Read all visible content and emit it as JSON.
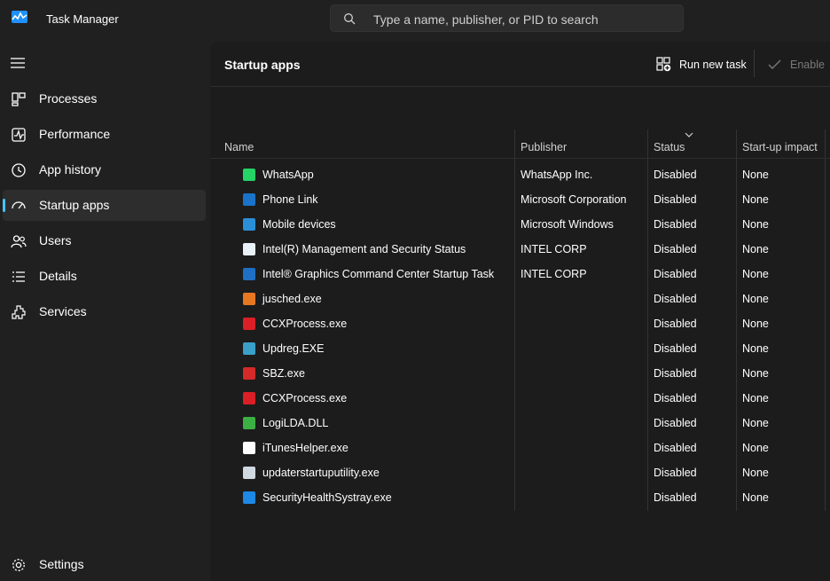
{
  "window": {
    "title": "Task Manager"
  },
  "search": {
    "placeholder": "Type a name, publisher, or PID to search"
  },
  "sidebar": {
    "items": [
      {
        "label": "Processes",
        "icon": "processes-icon"
      },
      {
        "label": "Performance",
        "icon": "performance-icon"
      },
      {
        "label": "App history",
        "icon": "app-history-icon"
      },
      {
        "label": "Startup apps",
        "icon": "startup-apps-icon",
        "active": true
      },
      {
        "label": "Users",
        "icon": "users-icon"
      },
      {
        "label": "Details",
        "icon": "details-icon"
      },
      {
        "label": "Services",
        "icon": "services-icon"
      }
    ],
    "settings_label": "Settings"
  },
  "page": {
    "title": "Startup apps",
    "run_new_task_label": "Run new task",
    "enable_label": "Enable"
  },
  "table": {
    "columns": {
      "name": "Name",
      "publisher": "Publisher",
      "status": "Status",
      "impact": "Start-up impact"
    },
    "rows": [
      {
        "name": "WhatsApp",
        "publisher": "WhatsApp Inc.",
        "status": "Disabled",
        "impact": "None",
        "icon": "whatsapp-icon",
        "color": "#25d366"
      },
      {
        "name": "Phone Link",
        "publisher": "Microsoft Corporation",
        "status": "Disabled",
        "impact": "None",
        "icon": "phone-link-icon",
        "color": "#1a73c8"
      },
      {
        "name": "Mobile devices",
        "publisher": "Microsoft Windows",
        "status": "Disabled",
        "impact": "None",
        "icon": "mobile-devices-icon",
        "color": "#2b8fd8"
      },
      {
        "name": "Intel(R) Management and Security Status",
        "publisher": "INTEL CORP",
        "status": "Disabled",
        "impact": "None",
        "icon": "intel-management-icon",
        "color": "#e8f0f8"
      },
      {
        "name": "Intel® Graphics Command Center Startup Task",
        "publisher": "INTEL CORP",
        "status": "Disabled",
        "impact": "None",
        "icon": "intel-graphics-icon",
        "color": "#1f6fc4"
      },
      {
        "name": "jusched.exe",
        "publisher": "",
        "status": "Disabled",
        "impact": "None",
        "icon": "java-icon",
        "color": "#e87722"
      },
      {
        "name": "CCXProcess.exe",
        "publisher": "",
        "status": "Disabled",
        "impact": "None",
        "icon": "adobe-cc-icon",
        "color": "#da1f26"
      },
      {
        "name": "Updreg.EXE",
        "publisher": "",
        "status": "Disabled",
        "impact": "None",
        "icon": "updreg-icon",
        "color": "#3aa0c8"
      },
      {
        "name": "SBZ.exe",
        "publisher": "",
        "status": "Disabled",
        "impact": "None",
        "icon": "sbz-icon",
        "color": "#d42a2a"
      },
      {
        "name": "CCXProcess.exe",
        "publisher": "",
        "status": "Disabled",
        "impact": "None",
        "icon": "adobe-cc-icon",
        "color": "#da1f26"
      },
      {
        "name": "LogiLDA.DLL",
        "publisher": "",
        "status": "Disabled",
        "impact": "None",
        "icon": "logi-icon",
        "color": "#3cb043"
      },
      {
        "name": "iTunesHelper.exe",
        "publisher": "",
        "status": "Disabled",
        "impact": "None",
        "icon": "itunes-icon",
        "color": "#ffffff"
      },
      {
        "name": "updaterstartuputility.exe",
        "publisher": "",
        "status": "Disabled",
        "impact": "None",
        "icon": "updater-icon",
        "color": "#d0d8e0"
      },
      {
        "name": "SecurityHealthSystray.exe",
        "publisher": "",
        "status": "Disabled",
        "impact": "None",
        "icon": "windows-security-icon",
        "color": "#1e88e5"
      }
    ]
  },
  "colors": {
    "accent": "#4cc2ff",
    "background": "#202020",
    "panel": "#1c1c1c"
  }
}
